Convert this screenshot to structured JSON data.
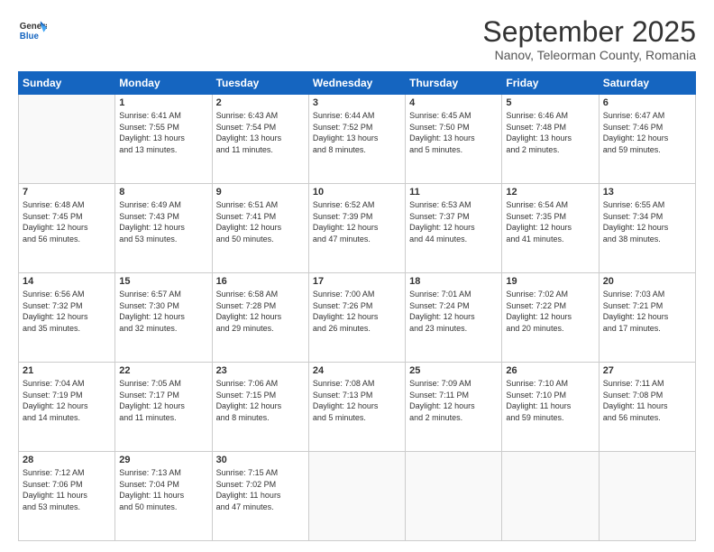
{
  "header": {
    "logo_line1": "General",
    "logo_line2": "Blue",
    "month": "September 2025",
    "location": "Nanov, Teleorman County, Romania"
  },
  "weekdays": [
    "Sunday",
    "Monday",
    "Tuesday",
    "Wednesday",
    "Thursday",
    "Friday",
    "Saturday"
  ],
  "weeks": [
    [
      {
        "day": "",
        "info": ""
      },
      {
        "day": "1",
        "info": "Sunrise: 6:41 AM\nSunset: 7:55 PM\nDaylight: 13 hours\nand 13 minutes."
      },
      {
        "day": "2",
        "info": "Sunrise: 6:43 AM\nSunset: 7:54 PM\nDaylight: 13 hours\nand 11 minutes."
      },
      {
        "day": "3",
        "info": "Sunrise: 6:44 AM\nSunset: 7:52 PM\nDaylight: 13 hours\nand 8 minutes."
      },
      {
        "day": "4",
        "info": "Sunrise: 6:45 AM\nSunset: 7:50 PM\nDaylight: 13 hours\nand 5 minutes."
      },
      {
        "day": "5",
        "info": "Sunrise: 6:46 AM\nSunset: 7:48 PM\nDaylight: 13 hours\nand 2 minutes."
      },
      {
        "day": "6",
        "info": "Sunrise: 6:47 AM\nSunset: 7:46 PM\nDaylight: 12 hours\nand 59 minutes."
      }
    ],
    [
      {
        "day": "7",
        "info": "Sunrise: 6:48 AM\nSunset: 7:45 PM\nDaylight: 12 hours\nand 56 minutes."
      },
      {
        "day": "8",
        "info": "Sunrise: 6:49 AM\nSunset: 7:43 PM\nDaylight: 12 hours\nand 53 minutes."
      },
      {
        "day": "9",
        "info": "Sunrise: 6:51 AM\nSunset: 7:41 PM\nDaylight: 12 hours\nand 50 minutes."
      },
      {
        "day": "10",
        "info": "Sunrise: 6:52 AM\nSunset: 7:39 PM\nDaylight: 12 hours\nand 47 minutes."
      },
      {
        "day": "11",
        "info": "Sunrise: 6:53 AM\nSunset: 7:37 PM\nDaylight: 12 hours\nand 44 minutes."
      },
      {
        "day": "12",
        "info": "Sunrise: 6:54 AM\nSunset: 7:35 PM\nDaylight: 12 hours\nand 41 minutes."
      },
      {
        "day": "13",
        "info": "Sunrise: 6:55 AM\nSunset: 7:34 PM\nDaylight: 12 hours\nand 38 minutes."
      }
    ],
    [
      {
        "day": "14",
        "info": "Sunrise: 6:56 AM\nSunset: 7:32 PM\nDaylight: 12 hours\nand 35 minutes."
      },
      {
        "day": "15",
        "info": "Sunrise: 6:57 AM\nSunset: 7:30 PM\nDaylight: 12 hours\nand 32 minutes."
      },
      {
        "day": "16",
        "info": "Sunrise: 6:58 AM\nSunset: 7:28 PM\nDaylight: 12 hours\nand 29 minutes."
      },
      {
        "day": "17",
        "info": "Sunrise: 7:00 AM\nSunset: 7:26 PM\nDaylight: 12 hours\nand 26 minutes."
      },
      {
        "day": "18",
        "info": "Sunrise: 7:01 AM\nSunset: 7:24 PM\nDaylight: 12 hours\nand 23 minutes."
      },
      {
        "day": "19",
        "info": "Sunrise: 7:02 AM\nSunset: 7:22 PM\nDaylight: 12 hours\nand 20 minutes."
      },
      {
        "day": "20",
        "info": "Sunrise: 7:03 AM\nSunset: 7:21 PM\nDaylight: 12 hours\nand 17 minutes."
      }
    ],
    [
      {
        "day": "21",
        "info": "Sunrise: 7:04 AM\nSunset: 7:19 PM\nDaylight: 12 hours\nand 14 minutes."
      },
      {
        "day": "22",
        "info": "Sunrise: 7:05 AM\nSunset: 7:17 PM\nDaylight: 12 hours\nand 11 minutes."
      },
      {
        "day": "23",
        "info": "Sunrise: 7:06 AM\nSunset: 7:15 PM\nDaylight: 12 hours\nand 8 minutes."
      },
      {
        "day": "24",
        "info": "Sunrise: 7:08 AM\nSunset: 7:13 PM\nDaylight: 12 hours\nand 5 minutes."
      },
      {
        "day": "25",
        "info": "Sunrise: 7:09 AM\nSunset: 7:11 PM\nDaylight: 12 hours\nand 2 minutes."
      },
      {
        "day": "26",
        "info": "Sunrise: 7:10 AM\nSunset: 7:10 PM\nDaylight: 11 hours\nand 59 minutes."
      },
      {
        "day": "27",
        "info": "Sunrise: 7:11 AM\nSunset: 7:08 PM\nDaylight: 11 hours\nand 56 minutes."
      }
    ],
    [
      {
        "day": "28",
        "info": "Sunrise: 7:12 AM\nSunset: 7:06 PM\nDaylight: 11 hours\nand 53 minutes."
      },
      {
        "day": "29",
        "info": "Sunrise: 7:13 AM\nSunset: 7:04 PM\nDaylight: 11 hours\nand 50 minutes."
      },
      {
        "day": "30",
        "info": "Sunrise: 7:15 AM\nSunset: 7:02 PM\nDaylight: 11 hours\nand 47 minutes."
      },
      {
        "day": "",
        "info": ""
      },
      {
        "day": "",
        "info": ""
      },
      {
        "day": "",
        "info": ""
      },
      {
        "day": "",
        "info": ""
      }
    ]
  ]
}
